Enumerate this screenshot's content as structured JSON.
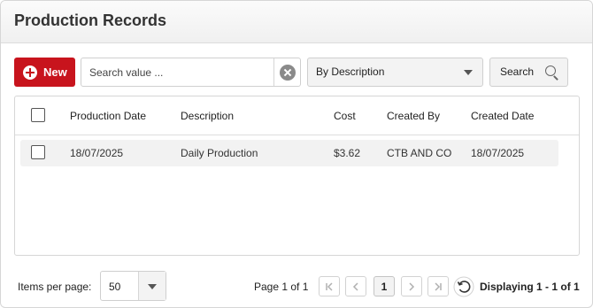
{
  "header": {
    "title": "Production Records"
  },
  "toolbar": {
    "new_label": "New",
    "search_placeholder": "Search value ...",
    "search_value": "",
    "filter_selected": "By Description",
    "search_button": "Search"
  },
  "grid": {
    "columns": [
      "Production Date",
      "Description",
      "Cost",
      "Created By",
      "Created Date"
    ],
    "rows": [
      {
        "production_date": "18/07/2025",
        "description": "Daily Production",
        "cost": "$3.62",
        "created_by": "CTB AND CO",
        "created_date": "18/07/2025"
      }
    ]
  },
  "pager": {
    "items_per_page_label": "Items per page:",
    "page_size": "50",
    "page_info": "Page 1 of 1",
    "current_page": "1",
    "displaying": "Displaying 1 - 1 of 1"
  },
  "colors": {
    "accent": "#c8141d",
    "row_background": "#f2f2f2"
  },
  "icons": [
    "plus-icon",
    "clear-icon",
    "chevron-down-icon",
    "search-icon",
    "first-page-icon",
    "prev-page-icon",
    "next-page-icon",
    "last-page-icon",
    "refresh-icon"
  ]
}
